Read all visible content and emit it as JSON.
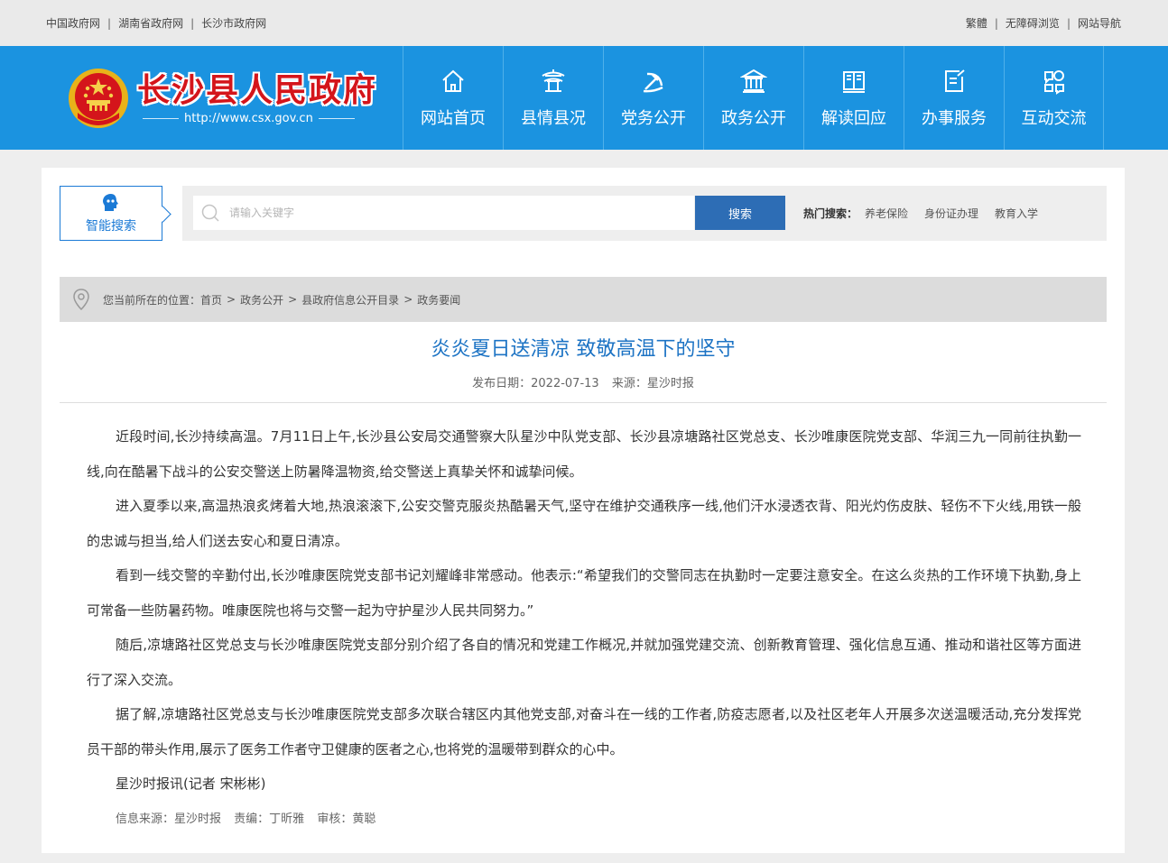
{
  "topbar": {
    "left_links": [
      "中国政府网",
      "湖南省政府网",
      "长沙市政府网"
    ],
    "right_links": [
      "繁體",
      "无障碍浏览",
      "网站导航"
    ]
  },
  "header": {
    "site_title": "长沙县人民政府",
    "site_url": "http://www.csx.gov.cn",
    "nav": [
      {
        "label": "网站首页",
        "icon": "home-icon"
      },
      {
        "label": "县情县况",
        "icon": "pavilion-icon"
      },
      {
        "label": "党务公开",
        "icon": "party-emblem-icon"
      },
      {
        "label": "政务公开",
        "icon": "government-building-icon"
      },
      {
        "label": "解读回应",
        "icon": "open-book-icon"
      },
      {
        "label": "办事服务",
        "icon": "document-edit-icon"
      },
      {
        "label": "互动交流",
        "icon": "interaction-icon"
      }
    ]
  },
  "search": {
    "smart_label": "智能搜索",
    "placeholder": "请输入关键字",
    "button_label": "搜索",
    "hot_title": "热门搜索：",
    "hot_items": [
      "养老保险",
      "身份证办理",
      "教育入学"
    ]
  },
  "breadcrumb": {
    "prefix": "您当前所在的位置：",
    "items": [
      "首页",
      "政务公开",
      "县政府信息公开目录",
      "政务要闻"
    ],
    "separator": ">"
  },
  "article": {
    "title": "炎炎夏日送清凉 致敬高温下的坚守",
    "date_label": "发布日期：2022-07-13",
    "source_label": "来源：星沙时报",
    "paragraphs": [
      "近段时间,长沙持续高温。7月11日上午,长沙县公安局交通警察大队星沙中队党支部、长沙县凉塘路社区党总支、长沙唯康医院党支部、华润三九一同前往执勤一线,向在酷暑下战斗的公安交警送上防暑降温物资,给交警送上真挚关怀和诚挚问候。",
      "进入夏季以来,高温热浪炙烤着大地,热浪滚滚下,公安交警克服炎热酷暑天气,坚守在维护交通秩序一线,他们汗水浸透衣背、阳光灼伤皮肤、轻伤不下火线,用铁一般的忠诚与担当,给人们送去安心和夏日清凉。",
      "看到一线交警的辛勤付出,长沙唯康医院党支部书记刘耀峰非常感动。他表示:“希望我们的交警同志在执勤时一定要注意安全。在这么炎热的工作环境下执勤,身上可常备一些防暑药物。唯康医院也将与交警一起为守护星沙人民共同努力。”",
      "随后,凉塘路社区党总支与长沙唯康医院党支部分别介绍了各自的情况和党建工作概况,并就加强党建交流、创新教育管理、强化信息互通、推动和谐社区等方面进行了深入交流。",
      "据了解,凉塘路社区党总支与长沙唯康医院党支部多次联合辖区内其他党支部,对奋斗在一线的工作者,防疫志愿者,以及社区老年人开展多次送温暖活动,充分发挥党员干部的带头作用,展示了医务工作者守卫健康的医者之心,也将党的温暖带到群众的心中。",
      "星沙时报讯(记者 宋彬彬)"
    ],
    "info_source": "信息来源：星沙时报",
    "editor": "责编：丁昕雅",
    "reviewer": "审核：黄聪"
  },
  "colors": {
    "header_blue": "#1b93e0",
    "title_blue": "#1c73c4",
    "button_blue": "#2d6db5",
    "logo_red": "#d4151b"
  }
}
